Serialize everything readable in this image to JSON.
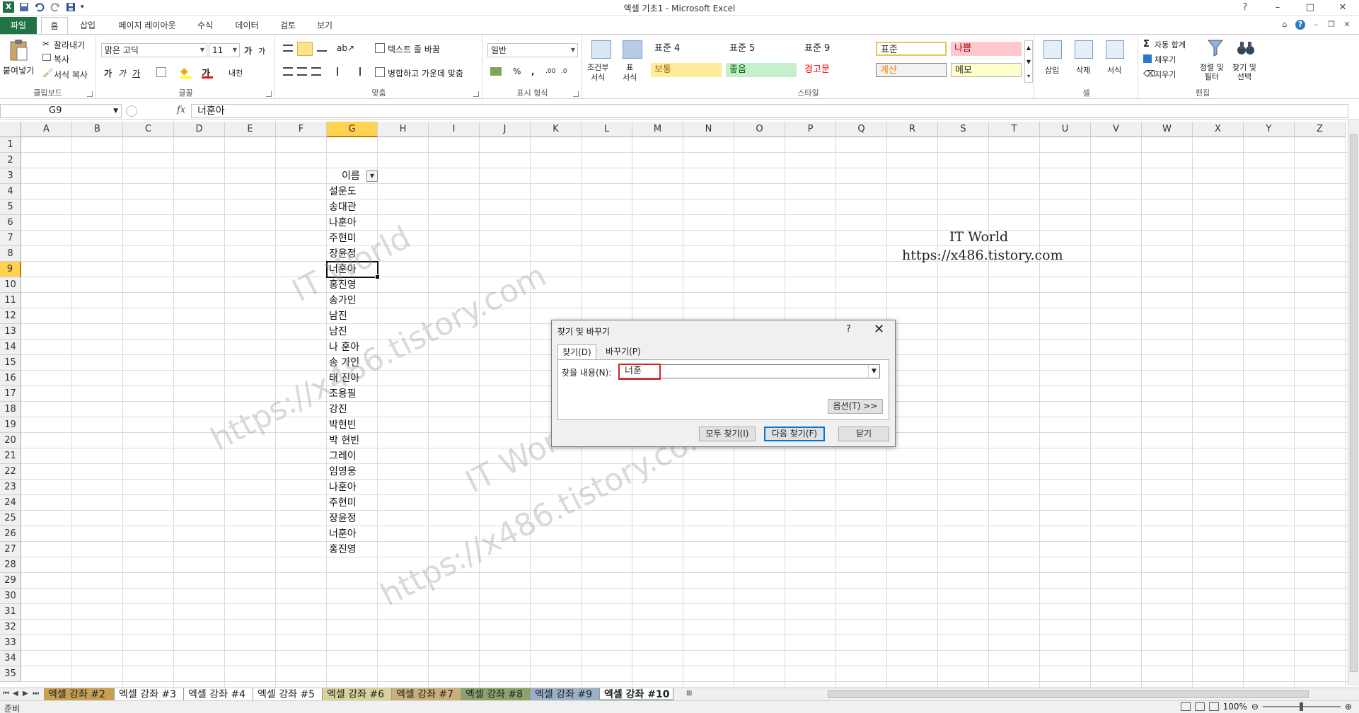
{
  "window": {
    "title": "엑셀 기초1  -  Microsoft Excel",
    "controls": [
      "?",
      "–",
      "□",
      "✕"
    ]
  },
  "ribbon_tabs": [
    "파일",
    "홈",
    "삽입",
    "페이지 레이아웃",
    "수식",
    "데이터",
    "검토",
    "보기"
  ],
  "ribbon": {
    "clipboard": {
      "label": "클립보드",
      "paste": "붙여넣기",
      "cut": "잘라내기",
      "copy": "복사",
      "format_painter": "서식 복사"
    },
    "font": {
      "label": "글꼴",
      "font_name": "맑은 고딕",
      "font_size": "11",
      "bold": "가",
      "italic": "가",
      "underline": "가",
      "increase": "가",
      "decrease": "가",
      "phonetic": "내천"
    },
    "alignment": {
      "label": "맞춤",
      "wrap_text": "텍스트 줄 바꿈",
      "merge_center": "병합하고 가운데 맞춤"
    },
    "number": {
      "label": "표시 형식",
      "format": "일반",
      "percent": "%",
      "comma": ","
    },
    "styles": {
      "label": "스타일",
      "conditional": "조건부\n서식",
      "table": "표\n서식",
      "cells": [
        {
          "text": "표준 4",
          "bg": "#ffffff",
          "fg": "#222222"
        },
        {
          "text": "표준 5",
          "bg": "#ffffff",
          "fg": "#222222"
        },
        {
          "text": "표준 9",
          "bg": "#ffffff",
          "fg": "#222222"
        },
        {
          "text": "표준",
          "bg": "#ffffff",
          "fg": "#222222"
        },
        {
          "text": "나쁨",
          "bg": "#ffc7ce",
          "fg": "#9c0006"
        },
        {
          "text": "보통",
          "bg": "#ffeb9c",
          "fg": "#9c6500"
        },
        {
          "text": "좋음",
          "bg": "#c6efce",
          "fg": "#006100"
        },
        {
          "text": "경고문",
          "bg": "#ffffff",
          "fg": "#ff0000"
        },
        {
          "text": "계산",
          "bg": "#f2f2f2",
          "fg": "#fa7d00"
        },
        {
          "text": "메모",
          "bg": "#ffffcc",
          "fg": "#222222"
        }
      ]
    },
    "cells_group": {
      "label": "셀",
      "insert": "삽입",
      "delete": "삭제",
      "format": "서식"
    },
    "editing": {
      "label": "편집",
      "autosum": "자동 합계",
      "fill": "채우기",
      "clear": "지우기",
      "sort_filter": "정렬 및\n필터",
      "find_select": "찾기 및\n선택"
    }
  },
  "formula_bar": {
    "name_box": "G9",
    "fx": "fx",
    "content": "너훈아"
  },
  "columns": [
    "A",
    "B",
    "C",
    "D",
    "E",
    "F",
    "G",
    "H",
    "I",
    "J",
    "K",
    "L",
    "M",
    "N",
    "O",
    "P",
    "Q",
    "R",
    "S",
    "T",
    "U",
    "V",
    "W",
    "X",
    "Y",
    "Z"
  ],
  "selected_column": "G",
  "rows": [
    "1",
    "2",
    "3",
    "4",
    "5",
    "6",
    "7",
    "8",
    "9",
    "10",
    "11",
    "12",
    "13",
    "14",
    "15",
    "16",
    "17",
    "18",
    "19",
    "20",
    "21",
    "22",
    "23",
    "24",
    "25",
    "26",
    "27",
    "28",
    "29",
    "30",
    "31",
    "32",
    "33",
    "34",
    "35"
  ],
  "selected_row": "9",
  "column_g_header": "이름",
  "column_g_values": [
    "설운도",
    "송대관",
    "나훈아",
    "주현미",
    "장윤정",
    "너훈아",
    "홍진영",
    "송가인",
    "남진",
    "남진",
    "나 훈아",
    "송 가인",
    "태 진아",
    "조용필",
    "강진",
    "박현빈",
    "박 현빈",
    "그레이",
    "임영웅",
    "나훈아",
    "주현미",
    "장윤정",
    "너훈아",
    "홍진영"
  ],
  "brand_text": {
    "line1": "IT World",
    "line2": "https://x486.tistory.com"
  },
  "dialog": {
    "title": "찾기 및 바꾸기",
    "help": "?",
    "close": "✕",
    "tab_find": "찾기(D)",
    "tab_replace": "바꾸기(P)",
    "find_label": "찾을 내용(N):",
    "find_value": "너훈",
    "options_button": "옵션(T) >>",
    "find_all_button": "모두 찾기(I)",
    "find_next_button": "다음 찾기(F)",
    "close_button": "닫기"
  },
  "sheet_tabs": [
    "엑셀 강좌 #2",
    "엑셀 강좌 #3",
    "엑셀 강좌 #4",
    "엑셀 강좌 #5",
    "엑셀 강좌 #6",
    "엑셀 강좌 #7",
    "엑셀 강좌 #8",
    "엑셀 강좌 #9",
    "엑셀 강좌 #10"
  ],
  "status": {
    "ready": "준비",
    "zoom": "100%"
  }
}
